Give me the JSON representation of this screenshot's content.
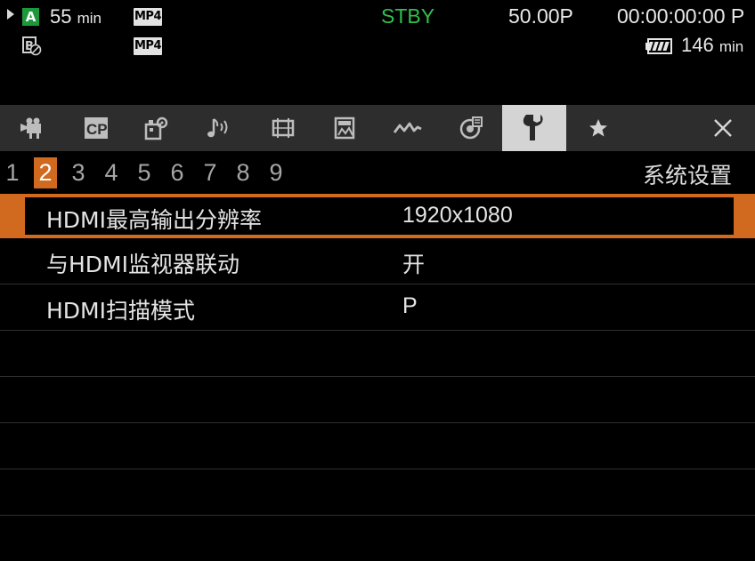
{
  "status": {
    "slot_a_label": "A",
    "remain_a_value": "55",
    "remain_a_unit": "min",
    "format_a": "MP4",
    "format_b": "MP4",
    "mode": "STBY",
    "frame_rate": "50.00P",
    "timecode": "00:00:00:00 P",
    "battery_value": "146",
    "battery_unit": "min",
    "colors": {
      "standby": "#2fc14a",
      "slot_a": "#1c9a3b",
      "accent": "#d16a1e"
    }
  },
  "tabs": [
    {
      "icon": "camera-icon"
    },
    {
      "icon": "custom-picture-icon",
      "label": "CP"
    },
    {
      "icon": "camera-settings-icon"
    },
    {
      "icon": "audio-icon"
    },
    {
      "icon": "video-setup-icon"
    },
    {
      "icon": "lcd-vf-icon"
    },
    {
      "icon": "tc-ub-icon"
    },
    {
      "icon": "recording-media-icon"
    },
    {
      "icon": "wrench-icon",
      "selected": true
    },
    {
      "icon": "star-icon"
    },
    {
      "icon": "close-icon"
    }
  ],
  "pages": {
    "numbers": [
      "1",
      "2",
      "3",
      "4",
      "5",
      "6",
      "7",
      "8",
      "9"
    ],
    "current": "2",
    "section_title": "系统设置"
  },
  "menu": {
    "rows": [
      {
        "label": "HDMI最高输出分辨率",
        "value": "1920x1080",
        "selected": true
      },
      {
        "label": "与HDMI监视器联动",
        "value": "开"
      },
      {
        "label": "HDMI扫描模式",
        "value": "P"
      }
    ]
  }
}
